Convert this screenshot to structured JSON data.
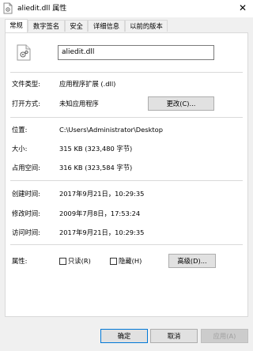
{
  "window": {
    "title": "aliedit.dll 属性",
    "close_glyph": "✕"
  },
  "tabs": [
    {
      "label": "常规",
      "active": true
    },
    {
      "label": "数字签名",
      "active": false
    },
    {
      "label": "安全",
      "active": false
    },
    {
      "label": "详细信息",
      "active": false
    },
    {
      "label": "以前的版本",
      "active": false
    }
  ],
  "general": {
    "filename": "aliedit.dll",
    "file_type_label": "文件类型:",
    "file_type_value": "应用程序扩展 (.dll)",
    "opens_with_label": "打开方式:",
    "opens_with_value": "未知应用程序",
    "change_button": "更改(C)...",
    "location_label": "位置:",
    "location_value": "C:\\Users\\Administrator\\Desktop",
    "size_label": "大小:",
    "size_value": "315 KB (323,480 字节)",
    "size_on_disk_label": "占用空间:",
    "size_on_disk_value": "316 KB (323,584 字节)",
    "created_label": "创建时间:",
    "created_value": "2017年9月21日，10:29:35",
    "modified_label": "修改时间:",
    "modified_value": "2009年7月8日，17:53:24",
    "accessed_label": "访问时间:",
    "accessed_value": "2017年9月21日，10:29:35",
    "attributes_label": "属性:",
    "readonly_label": "只读(R)",
    "hidden_label": "隐藏(H)",
    "advanced_button": "高级(D)..."
  },
  "footer": {
    "ok": "确定",
    "cancel": "取消",
    "apply": "应用(A)"
  },
  "colors": {
    "accent": "#0078d7",
    "panel_bg": "#ffffff",
    "window_bg": "#f0f0f0"
  }
}
